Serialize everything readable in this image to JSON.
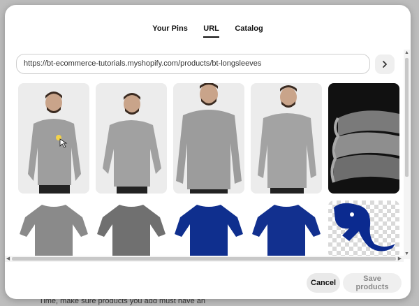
{
  "tabs": [
    {
      "label": "Your Pins"
    },
    {
      "label": "URL"
    },
    {
      "label": "Catalog"
    }
  ],
  "url_field": {
    "value": "https://bt-ecommerce-tutorials.myshopify.com/products/bt-longsleeves"
  },
  "go_button": {
    "icon": "chevron-right-icon"
  },
  "images": [
    {
      "alt": "man in grey sweatshirt front"
    },
    {
      "alt": "man in grey sweatshirt angled"
    },
    {
      "alt": "man in grey sweatshirt close"
    },
    {
      "alt": "man in grey sweatshirt side"
    },
    {
      "alt": "folded grey sweaters"
    },
    {
      "alt": "grey long sleeve shirt"
    },
    {
      "alt": "dark grey long sleeve shirt"
    },
    {
      "alt": "blue long sleeve shirt"
    },
    {
      "alt": "blue long sleeve shirt front"
    },
    {
      "alt": "blue elephant logo"
    }
  ],
  "footer": {
    "cancel_label": "Cancel",
    "save_label": "Save products"
  },
  "backdrop_text": "Time, make sure products you add must have an",
  "colors": {
    "shirt_grey": "#8a8a8a",
    "shirt_blue": "#0f2f8e",
    "logo_blue": "#0b2a8f"
  }
}
